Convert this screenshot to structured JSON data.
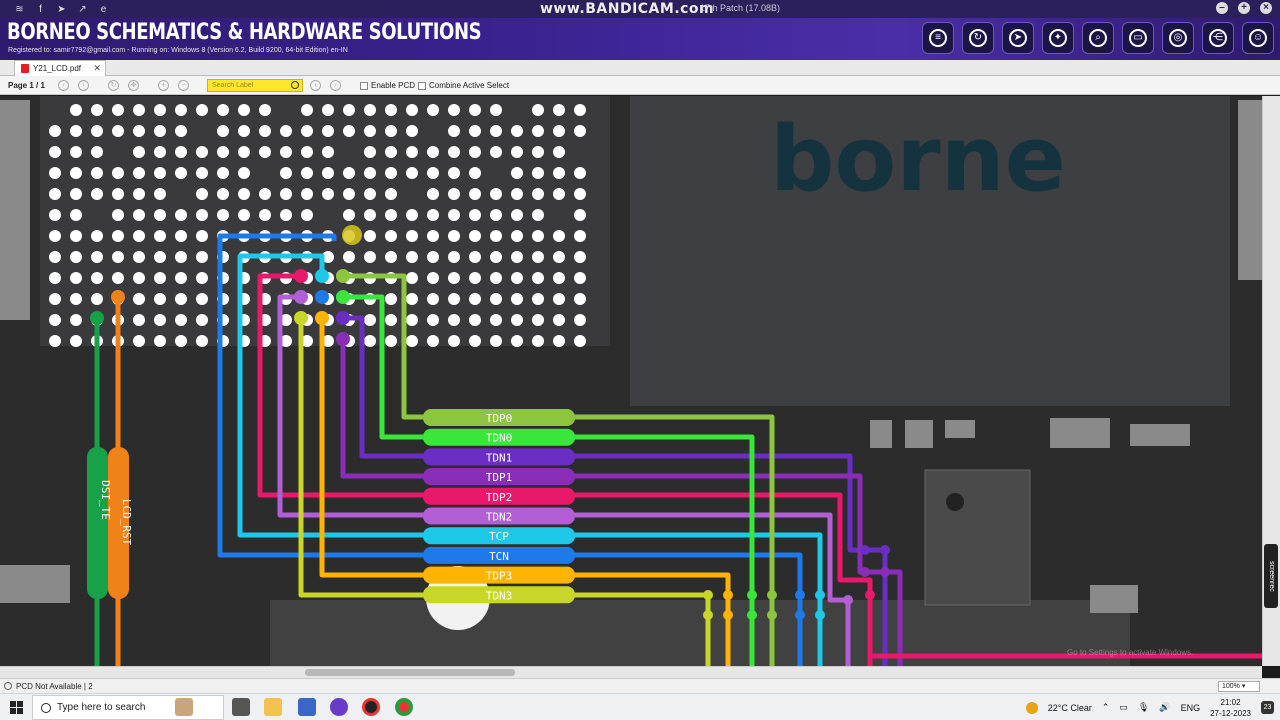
{
  "window": {
    "recorder_watermark": "www.BANDICAM.com",
    "patch_text": "17th Patch (17.08B)",
    "titlebar_icons": [
      "app-icon",
      "facebook-icon",
      "telegram-icon",
      "share-icon",
      "edge-icon"
    ],
    "controls": [
      "minimize",
      "maximize",
      "close"
    ]
  },
  "header": {
    "brand": "BORNEO SCHEMATICS & HARDWARE SOLUTIONS",
    "registered": "Registered to: samir7792@gmail.com - Running on: Windows 8 (Version 6.2, Build 9200, 64-bit Edition) en-IN",
    "tool_icons": [
      "book-icon",
      "refresh-icon",
      "pointer-icon",
      "magic-wand-icon",
      "search-zoom-icon",
      "folder-icon",
      "scan-icon",
      "share-nodes-icon",
      "user-icon"
    ]
  },
  "tab": {
    "file_name": "Y21_LCD.pdf",
    "close": "✕"
  },
  "controls": {
    "page": "Page 1 / 1",
    "search_placeholder": "Search Label",
    "enable_pcd": "Enable PCD",
    "combine_active": "Combine Active Select"
  },
  "board": {
    "labels": [
      "TDP0",
      "TDN0",
      "TDN1",
      "TDP1",
      "TDP2",
      "TDN2",
      "TCP",
      "TCN",
      "TDP3",
      "TDN3"
    ],
    "label_colors": [
      "#8cc63f",
      "#39e639",
      "#6a2ec4",
      "#8a2eb8",
      "#e8196b",
      "#b25fd6",
      "#1ec8e8",
      "#1e7ae8",
      "#ffb400",
      "#c8d62a"
    ],
    "side_labels": [
      "DSI_TE",
      "LCD_RST"
    ],
    "side_colors": [
      "#17a24a",
      "#f0821a"
    ],
    "chip_text": "borne",
    "screenrec": "screenrec",
    "activate_text": "Go to Settings to activate Windows."
  },
  "status": {
    "text": "PCD Not Available | 2",
    "zoom": "100%"
  },
  "taskbar": {
    "search_placeholder": "Type here to search",
    "weather": "22°C  Clear",
    "lang": "ENG",
    "time": "21:02",
    "date": "27-12-2023",
    "notifications": "23"
  }
}
